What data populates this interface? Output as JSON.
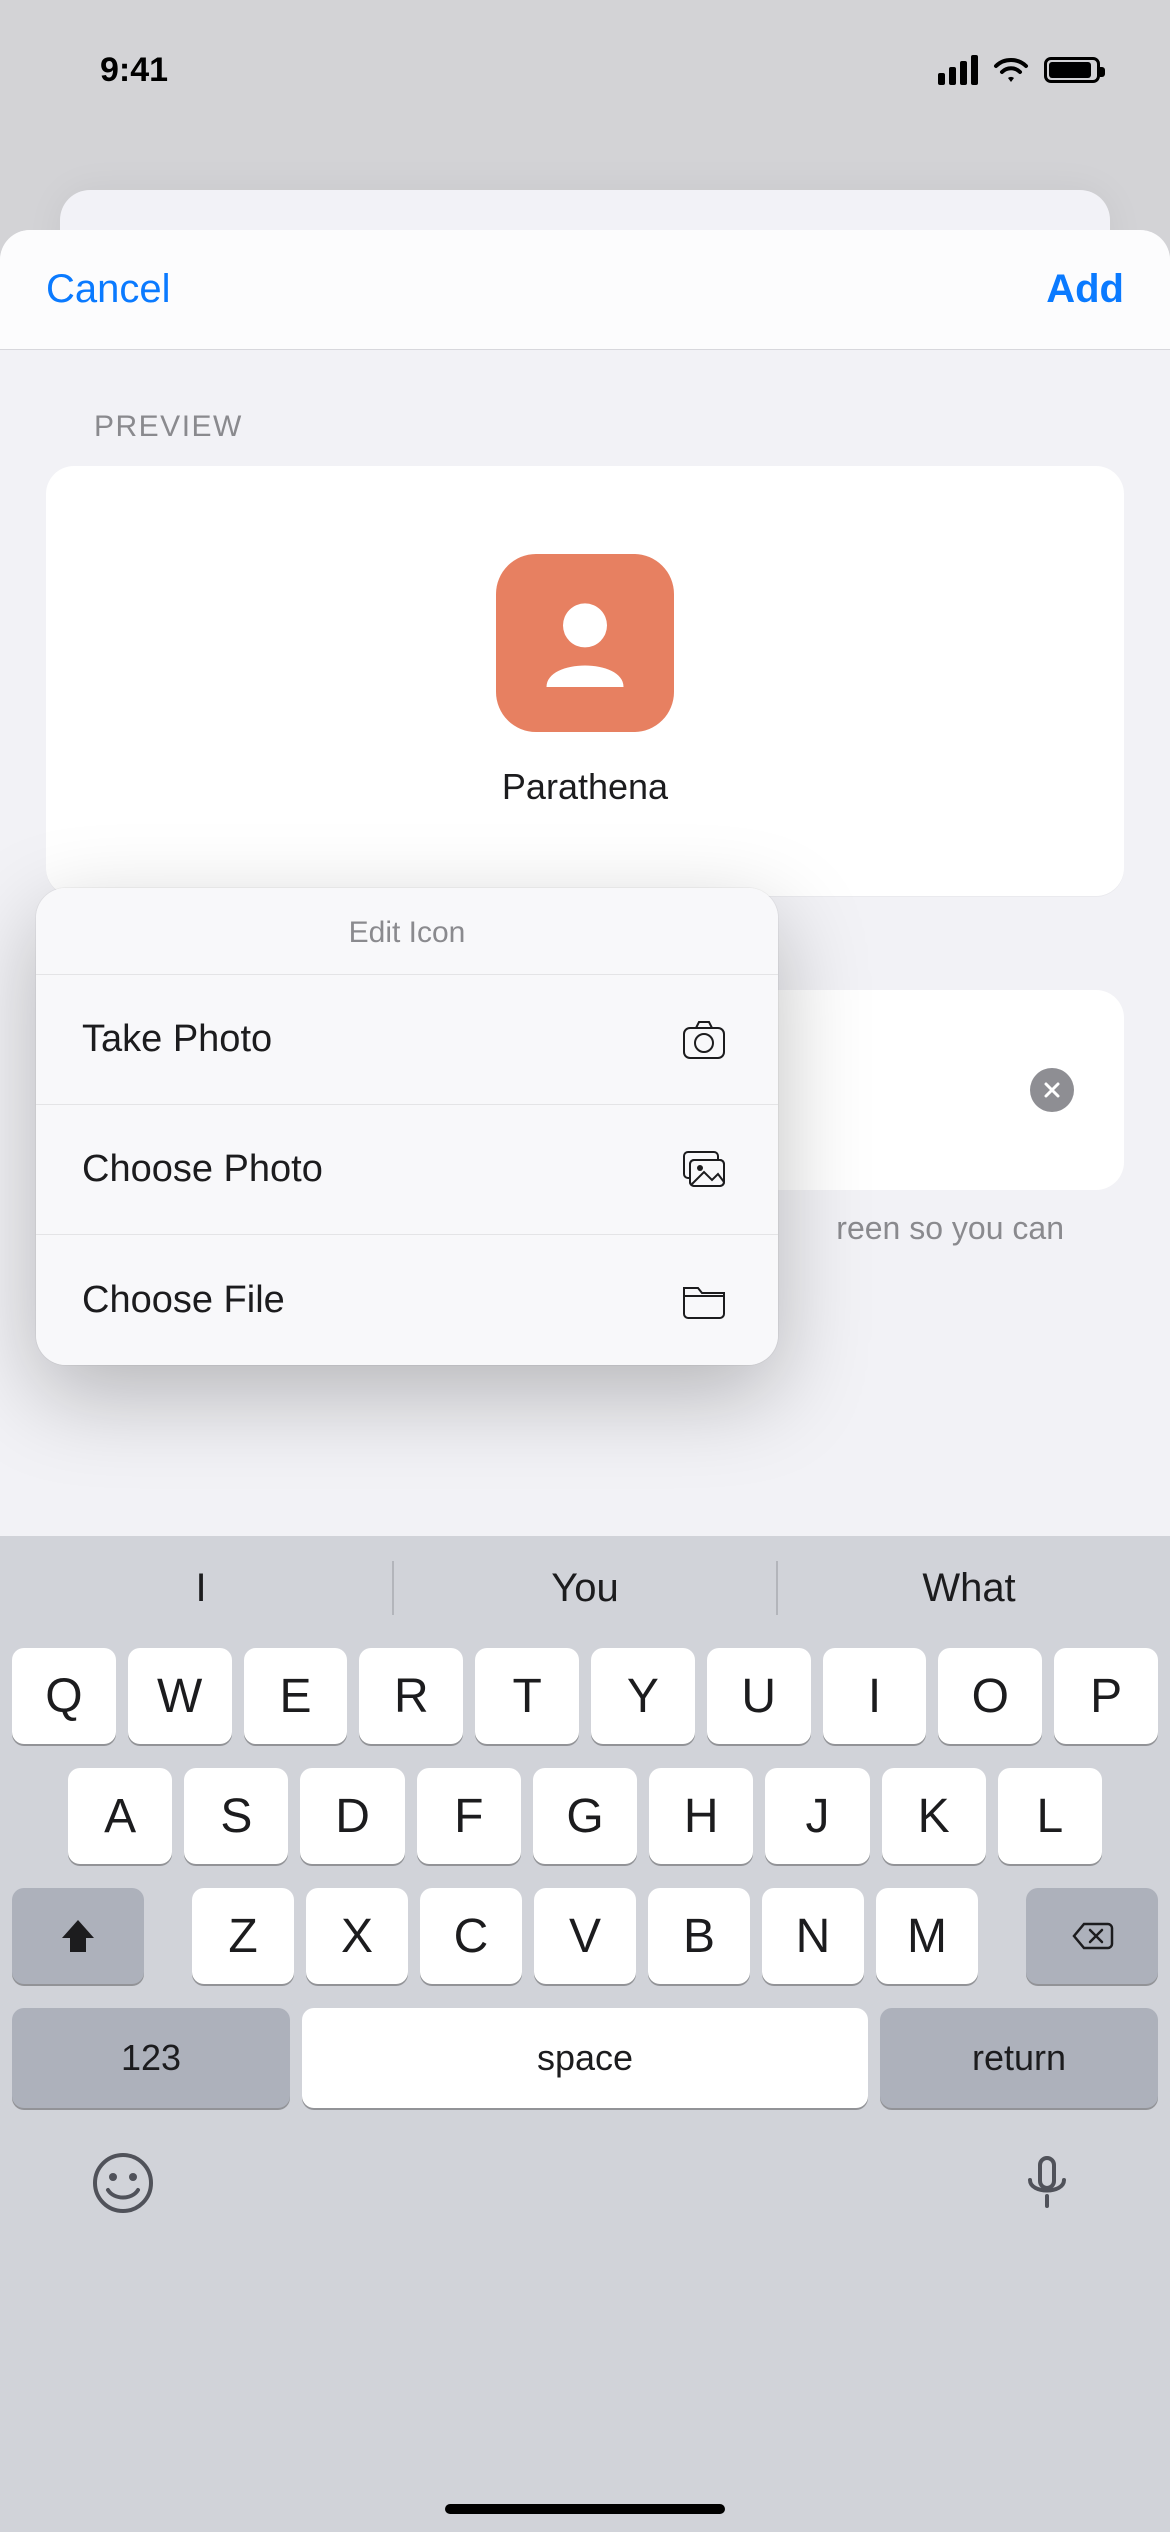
{
  "status": {
    "time": "9:41"
  },
  "nav": {
    "cancel": "Cancel",
    "add": "Add"
  },
  "sections": {
    "preview": "PREVIEW"
  },
  "preview": {
    "name": "Parathena",
    "icon_bg": "#e78061"
  },
  "popover": {
    "title": "Edit Icon",
    "items": [
      {
        "label": "Take Photo",
        "icon": "camera"
      },
      {
        "label": "Choose Photo",
        "icon": "photos"
      },
      {
        "label": "Choose File",
        "icon": "folder"
      }
    ]
  },
  "bg_text": {
    "helper_fragment": "reen so you can"
  },
  "keyboard": {
    "suggestions": [
      "I",
      "You",
      "What"
    ],
    "row1": [
      "Q",
      "W",
      "E",
      "R",
      "T",
      "Y",
      "U",
      "I",
      "O",
      "P"
    ],
    "row2": [
      "A",
      "S",
      "D",
      "F",
      "G",
      "H",
      "J",
      "K",
      "L"
    ],
    "row3": [
      "Z",
      "X",
      "C",
      "V",
      "B",
      "N",
      "M"
    ],
    "num_key": "123",
    "space_key": "space",
    "return_key": "return"
  }
}
